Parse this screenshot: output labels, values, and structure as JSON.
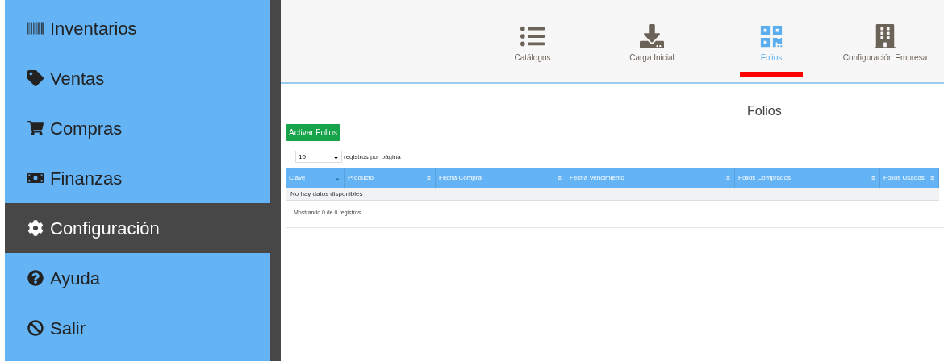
{
  "sidebar": {
    "items": [
      {
        "label": "Inventarios",
        "selected": false
      },
      {
        "label": "Ventas",
        "selected": false
      },
      {
        "label": "Compras",
        "selected": false
      },
      {
        "label": "Finanzas",
        "selected": false
      },
      {
        "label": "Configuración",
        "selected": true
      },
      {
        "label": "Ayuda",
        "selected": false
      },
      {
        "label": "Salir",
        "selected": false
      }
    ]
  },
  "tabs": [
    {
      "label": "Catálogos",
      "selected": false
    },
    {
      "label": "Carga Inicial",
      "selected": false
    },
    {
      "label": "Folios",
      "selected": true
    },
    {
      "label": "Configuración Empresa",
      "selected": false
    }
  ],
  "page_title": "Folios",
  "activate_button": "Activar Folios",
  "page_size": {
    "value": "10",
    "label": "registros por página"
  },
  "table": {
    "columns": [
      {
        "label": "Clave",
        "sorted": true
      },
      {
        "label": "Producto",
        "sorted": false
      },
      {
        "label": "Fecha Compra",
        "sorted": false
      },
      {
        "label": "Fecha Vencimiento",
        "sorted": false
      },
      {
        "label": "Folios Comprados",
        "sorted": false
      },
      {
        "label": "Folios Usados",
        "sorted": false
      }
    ],
    "empty_message": "No hay datos disponibles"
  },
  "footer": "Mostrando 0 de 0 registros"
}
